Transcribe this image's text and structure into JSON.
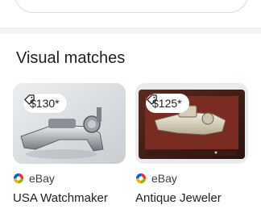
{
  "section": {
    "title": "Visual matches"
  },
  "results": [
    {
      "price": "$130*",
      "source": "eBay",
      "title": "USA Watchmaker"
    },
    {
      "price": "$125*",
      "source": "eBay",
      "title": "Antique Jeweler"
    }
  ],
  "colors": {
    "chip_bg": "#ffffff",
    "divider": "#f1f3f4",
    "ebay_red": "#e53238",
    "ebay_blue": "#0064d2",
    "ebay_yellow": "#f5af02",
    "ebay_green": "#86b817"
  },
  "icons": {
    "price_tag": "tag-icon",
    "source_favicon": "ebay-favicon-icon"
  }
}
